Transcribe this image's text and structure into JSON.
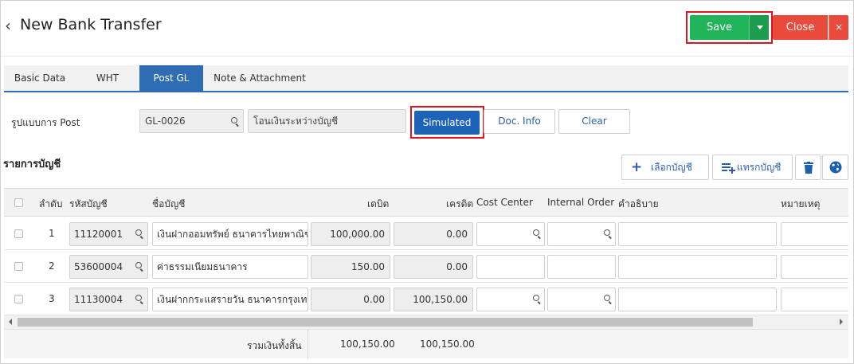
{
  "header": {
    "back_glyph": "‹",
    "title": "New Bank Transfer",
    "save_label": "Save",
    "close_label": "Close",
    "close_x": "×"
  },
  "tabs": [
    {
      "label": "Basic Data",
      "active": false
    },
    {
      "label": "WHT",
      "active": false
    },
    {
      "label": "Post GL",
      "active": true
    },
    {
      "label": "Note & Attachment",
      "active": false
    }
  ],
  "post": {
    "label": "รูปแบบการ Post",
    "code": "GL-0026",
    "name": "โอนเงินระหว่างบัญชี",
    "simulated_label": "Simulated",
    "docinfo_label": "Doc. Info",
    "clear_label": "Clear"
  },
  "section": {
    "title": "รายการบัญชี",
    "select_account_label": "เลือกบัญชี",
    "insert_account_label": "แทรกบัญชี"
  },
  "table": {
    "headers": {
      "seq": "ลำดับ",
      "code": "รหัสบัญชี",
      "name": "ชื่อบัญชี",
      "debit": "เดบิต",
      "credit": "เครดิต",
      "cost_center": "Cost Center",
      "internal_order": "Internal Order",
      "description": "คำอธิบาย",
      "remark": "หมายเหตุ"
    },
    "rows": [
      {
        "seq": "1",
        "code": "11120001",
        "name": "เงินฝากออมทรัพย์ ธนาคารไทยพาณิชย์",
        "debit": "100,000.00",
        "credit": "0.00"
      },
      {
        "seq": "2",
        "code": "53600004",
        "name": "ค่าธรรมเนียมธนาคาร",
        "debit": "150.00",
        "credit": "0.00"
      },
      {
        "seq": "3",
        "code": "11130004",
        "name": "เงินฝากกระแสรายวัน ธนาคารกรุงเทพ",
        "debit": "0.00",
        "credit": "100,150.00"
      }
    ],
    "totals": {
      "label": "รวมเงินทั้งสิ้น",
      "debit": "100,150.00",
      "credit": "100,150.00"
    }
  },
  "colors": {
    "save_green": "#22b45a",
    "close_red": "#e84a3c",
    "tab_blue": "#2e6db4",
    "simulated_blue": "#1d64b8",
    "highlight_red": "#e0141e"
  },
  "icons": [
    "back-arrow-icon",
    "caret-down-icon",
    "close-icon",
    "search-icon",
    "plus-icon",
    "insert-list-icon",
    "trash-icon",
    "globe-icon"
  ]
}
